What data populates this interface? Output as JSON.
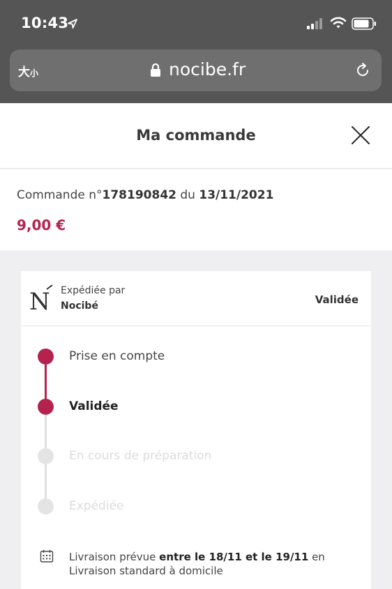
{
  "status_bar": {
    "time": "10:43"
  },
  "browser": {
    "text_size_label_big": "大",
    "text_size_label_small": "小",
    "url": "nocibe.fr"
  },
  "header": {
    "title": "Ma commande"
  },
  "order": {
    "prefix": "Commande n°",
    "number": "178190842",
    "middle": " du ",
    "date": "13/11/2021",
    "price": "9,00 €"
  },
  "shipment": {
    "logo": "N",
    "shipped_by_label": "Expédiée par",
    "shipper": "Nocibé",
    "status": "Validée",
    "steps": [
      {
        "label": "Prise en compte",
        "state": "done"
      },
      {
        "label": "Validée",
        "state": "current"
      },
      {
        "label": "En cours de préparation",
        "state": "todo"
      },
      {
        "label": "Expédiée",
        "state": "todo"
      }
    ],
    "delivery": {
      "prefix": "Livraison prévue ",
      "range": "entre le 18/11 et le 19/11",
      "suffix": " en",
      "method": "Livraison standard à domicile"
    }
  },
  "colors": {
    "accent": "#b5224e",
    "chrome": "#555555",
    "background": "#efeef1"
  },
  "icons": [
    "location-arrow-icon",
    "signal-icon",
    "wifi-icon",
    "battery-icon",
    "lock-icon",
    "reload-icon",
    "close-icon",
    "calendar-icon"
  ]
}
